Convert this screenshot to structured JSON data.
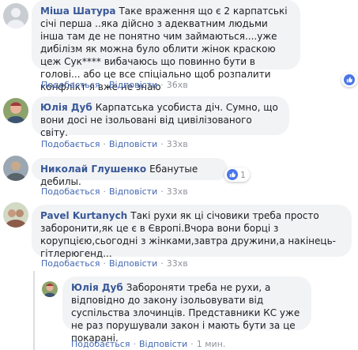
{
  "comments": [
    {
      "author": "Міша Шатура",
      "text": "Таке враження що є 2 карпатські січі перша ..яка дійсно з адекватним людьми інша там де не понятно чим займаються....уже дибілізм як можна було облити жінок краскою цеж Сук**** вибачаюсь що повинно бути в голові... або це все спіціально щоб розпалити конфлікт я вже не знаю",
      "like_label": "Подобається",
      "reply_label": "Відповісти",
      "time": "36хв"
    },
    {
      "author": "Юлія Дуб",
      "text": "Карпатська усобиста діч. Сумно, що вони досі не ізольовані від цивілізованого світу.",
      "like_label": "Подобається",
      "reply_label": "Відповісти",
      "time": "33хв"
    },
    {
      "author": "Николай Глушенко",
      "text": "Ебанутые дебилы.",
      "like_label": "Подобається",
      "reply_label": "Відповісти",
      "time": "33хв",
      "reaction_count": "1"
    },
    {
      "author": "Pavel Kurtanych",
      "text": "Такі рухи як ці січовики треба просто заборонити,як це є в Європі.Вчора вони борці з корупцією,сьогодні з жінками,завтра дружини,а накінець-гітлерюгенд...",
      "like_label": "Подобається",
      "reply_label": "Відповісти",
      "time": "33хв"
    }
  ],
  "reply": {
    "author": "Юлія Дуб",
    "text": "Забороняти треба не рухи, а відповідно до закону ізольовувати від суспільства злочинців. Представники КС уже не раз порушували закон і мають бути за це покарані.",
    "like_label": "Подобається",
    "reply_label": "Відповісти",
    "time": "1 мин."
  },
  "colors": {
    "author": "#385898",
    "link": "#4267b2",
    "meta": "#90949c",
    "bubble": "#f2f3f5",
    "like_badge": "#4a76e8"
  },
  "icons": [
    "like-icon",
    "avatar"
  ]
}
